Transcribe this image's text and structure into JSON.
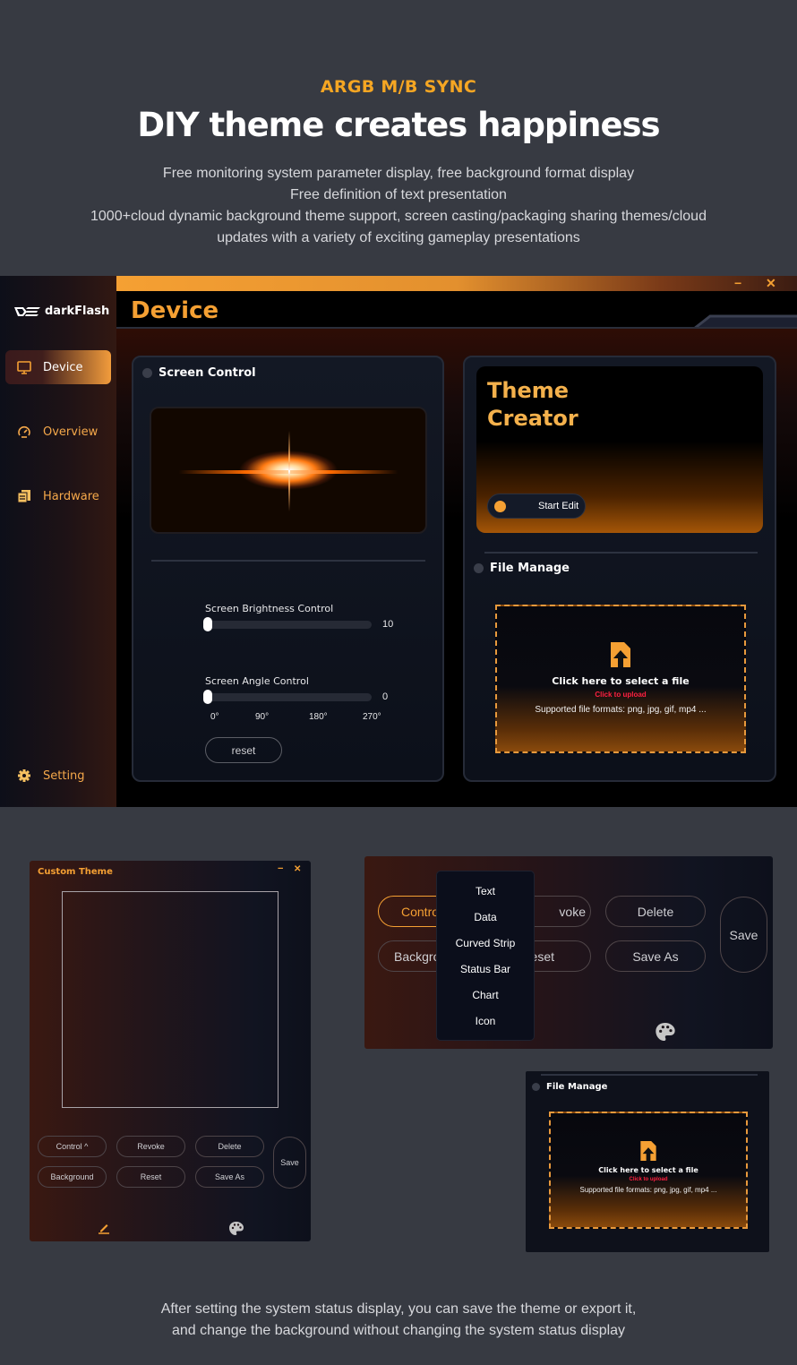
{
  "marketing": {
    "kicker": "ARGB M/B SYNC",
    "headline": "DIY theme creates happiness",
    "description_lines": [
      "Free monitoring system parameter display, free background format display",
      "Free definition of text presentation",
      "1000+cloud dynamic background theme support, screen casting/packaging sharing themes/cloud",
      "updates with a variety of exciting gameplay presentations"
    ],
    "footer_lines": [
      "After setting the system status display, you can save the theme or export it,",
      "and change the background without changing the system status display"
    ]
  },
  "app": {
    "brand": "darkFlash",
    "page_title": "Device",
    "window_controls": {
      "minimize": "−",
      "close": "✕"
    },
    "sidebar": {
      "items": [
        {
          "label": "Device",
          "icon": "monitor-icon",
          "active": true
        },
        {
          "label": "Overview",
          "icon": "speedometer-icon",
          "active": false
        },
        {
          "label": "Hardware",
          "icon": "documents-icon",
          "active": false
        }
      ],
      "setting": {
        "label": "Setting",
        "icon": "gear-icon"
      }
    },
    "screen_control": {
      "title": "Screen Control",
      "brightness": {
        "label": "Screen Brightness Control",
        "value": "10",
        "fraction": 0
      },
      "angle": {
        "label": "Screen Angle Control",
        "value": "0",
        "fraction": 0,
        "ticks": [
          "0°",
          "90°",
          "180°",
          "270°"
        ]
      },
      "reset_label": "reset"
    },
    "theme_creator": {
      "title_line1": "Theme",
      "title_line2": "Creator",
      "start_label": "Start Edit"
    },
    "file_manage": {
      "title": "File Manage",
      "select_label": "Click here to select a file",
      "upload_label": "Click to upload",
      "formats_label": "Supported file formats: png, jpg, gif, mp4 ..."
    }
  },
  "custom_theme": {
    "title": "Custom Theme",
    "controls": {
      "minimize": "−",
      "close": "✕"
    },
    "buttons": {
      "control": "Control ^",
      "revoke": "Revoke",
      "delete": "Delete",
      "background": "Background",
      "reset": "Reset",
      "save_as": "Save As",
      "save": "Save"
    }
  },
  "control_popup": {
    "buttons": {
      "control": "Contro",
      "revoke": "voke",
      "delete": "Delete",
      "background": "Backgro",
      "reset": "eset",
      "save_as": "Save As",
      "save": "Save"
    },
    "menu_items": [
      "Text",
      "Data",
      "Curved Strip",
      "Status Bar",
      "Chart",
      "Icon"
    ]
  },
  "file_manage_mini": {
    "title": "File Manage",
    "select_label": "Click here to select a file",
    "upload_label": "Click to upload",
    "formats_label": "Supported file formats: png, jpg, gif, mp4 ..."
  },
  "colors": {
    "accent": "#f5a033",
    "upload_red": "#ff2040",
    "page_bg": "#373a42"
  }
}
